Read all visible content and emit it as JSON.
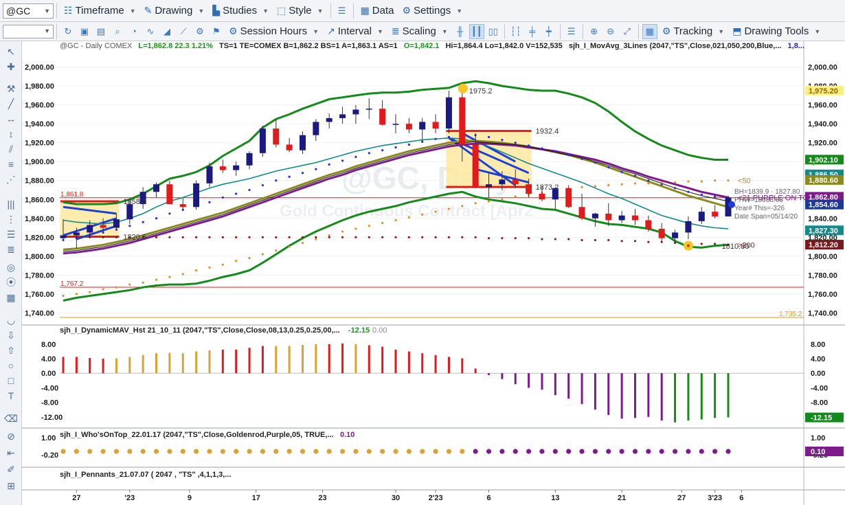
{
  "toolbar1": {
    "symbol": "@GC",
    "timeframe": "Timeframe",
    "drawing": "Drawing",
    "studies": "Studies",
    "style": "Style",
    "data": "Data",
    "settings": "Settings"
  },
  "toolbar2": {
    "session_hours": "Session Hours",
    "interval": "Interval",
    "scaling": "Scaling",
    "tracking": "Tracking",
    "drawing_tools": "Drawing Tools"
  },
  "header": {
    "symbol_label": "@GC - Daily  COMEX",
    "stats": "L=1,862.8  22.3  1.21%",
    "quote": "TS=1  TE=COMEX  B=1,862.2  BS=1  A=1,863.1  AS=1",
    "ohlcv": "O=1,842.1  Hi=1,864.4  Lo=1,842.0  V=152,535",
    "study": "sjh_I_MovAvg_3Lines (2047,\"TS\",Close,021,050,200,Blue,...",
    "study_tail": "1,8..."
  },
  "watermark": {
    "symbol": "@GC, Daily",
    "description": "Gold Continuous Contract [Apr2"
  },
  "colors": {
    "up_candle": "#1a1a80",
    "down_candle": "#e31a1a",
    "bb_band": "#138a1a",
    "ma_teal": "#138a8a",
    "ma_olive": "#8b8a1c",
    "ma_purple": "#7d1a8c",
    "hist_red": "#e21a1a",
    "hist_gold": "#dca231",
    "hist_purple": "#7e1a8d",
    "hist_green": "#148a1a"
  },
  "chart_data": {
    "type": "candlestick",
    "price_axis": {
      "ticks": [
        "2,000.00",
        "1,980.00",
        "1,960.00",
        "1,940.00",
        "1,920.00",
        "1,900.00",
        "1,880.00",
        "1,860.00",
        "1,840.00",
        "1,820.00",
        "1,800.00",
        "1,780.00",
        "1,760.00",
        "1,740.00"
      ],
      "ylim": [
        1733,
        2007
      ]
    },
    "date_axis": [
      "27",
      "'23",
      "9",
      "17",
      "23",
      "30",
      "2'23",
      "6",
      "13",
      "21",
      "27",
      "3'23",
      "6"
    ],
    "candles": [
      [
        1819,
        1839,
        1816,
        1822
      ],
      [
        1822,
        1830,
        1808,
        1825
      ],
      [
        1825,
        1838,
        1820,
        1833
      ],
      [
        1833,
        1840,
        1825,
        1830
      ],
      [
        1830,
        1845,
        1828,
        1839
      ],
      [
        1839,
        1858,
        1834,
        1855
      ],
      [
        1855,
        1873,
        1850,
        1868
      ],
      [
        1868,
        1878,
        1862,
        1876
      ],
      [
        1876,
        1880,
        1855,
        1855
      ],
      [
        1855,
        1862,
        1848,
        1852
      ],
      [
        1852,
        1880,
        1849,
        1877
      ],
      [
        1877,
        1899,
        1873,
        1895
      ],
      [
        1895,
        1902,
        1888,
        1891
      ],
      [
        1891,
        1900,
        1885,
        1896
      ],
      [
        1896,
        1911,
        1892,
        1909
      ],
      [
        1909,
        1938,
        1905,
        1935
      ],
      [
        1935,
        1945,
        1915,
        1918
      ],
      [
        1918,
        1925,
        1910,
        1912
      ],
      [
        1912,
        1932,
        1908,
        1928
      ],
      [
        1928,
        1945,
        1922,
        1942
      ],
      [
        1942,
        1951,
        1935,
        1946
      ],
      [
        1946,
        1958,
        1940,
        1950
      ],
      [
        1950,
        1960,
        1940,
        1955
      ],
      [
        1955,
        1967,
        1945,
        1956
      ],
      [
        1956,
        1965,
        1938,
        1939
      ],
      [
        1939,
        1950,
        1930,
        1940
      ],
      [
        1940,
        1946,
        1930,
        1934
      ],
      [
        1934,
        1946,
        1920,
        1942
      ],
      [
        1942,
        1950,
        1930,
        1935
      ],
      [
        1935,
        1975,
        1930,
        1968
      ],
      [
        1968,
        1975,
        1900,
        1918
      ],
      [
        1918,
        1930,
        1872,
        1873
      ],
      [
        1873,
        1888,
        1862,
        1876
      ],
      [
        1876,
        1890,
        1870,
        1881
      ],
      [
        1881,
        1892,
        1872,
        1876
      ],
      [
        1876,
        1882,
        1862,
        1866
      ],
      [
        1866,
        1874,
        1858,
        1860
      ],
      [
        1860,
        1873,
        1850,
        1872
      ],
      [
        1872,
        1875,
        1851,
        1852
      ],
      [
        1852,
        1866,
        1838,
        1840
      ],
      [
        1840,
        1846,
        1831,
        1845
      ],
      [
        1845,
        1856,
        1832,
        1838
      ],
      [
        1838,
        1848,
        1835,
        1843
      ],
      [
        1843,
        1850,
        1833,
        1838
      ],
      [
        1838,
        1843,
        1826,
        1829
      ],
      [
        1829,
        1835,
        1815,
        1819
      ],
      [
        1819,
        1828,
        1814,
        1825
      ],
      [
        1825,
        1842,
        1818,
        1837
      ],
      [
        1837,
        1852,
        1834,
        1847
      ],
      [
        1847,
        1854,
        1840,
        1842
      ],
      [
        1842,
        1864,
        1842,
        1862
      ]
    ],
    "ma21": [
      1838,
      1836,
      1835,
      1834,
      1836,
      1840,
      1845,
      1852,
      1858,
      1862,
      1867,
      1872,
      1876,
      1879,
      1882,
      1886,
      1890,
      1893,
      1896,
      1899,
      1903,
      1907,
      1911,
      1914,
      1917,
      1919,
      1921,
      1923,
      1924,
      1925,
      1924,
      1921,
      1916,
      1910,
      1904,
      1898,
      1893,
      1888,
      1883,
      1878,
      1872,
      1866,
      1861,
      1855,
      1849,
      1843,
      1839,
      1835,
      1832,
      1830,
      1829
    ],
    "bb_upper": [
      1857,
      1855,
      1855,
      1855,
      1856,
      1860,
      1866,
      1874,
      1882,
      1885,
      1889,
      1896,
      1906,
      1914,
      1922,
      1936,
      1945,
      1950,
      1956,
      1961,
      1966,
      1968,
      1970,
      1972,
      1973,
      1973,
      1974,
      1976,
      1977,
      1978,
      1983,
      1985,
      1983,
      1980,
      1978,
      1976,
      1975,
      1975,
      1972,
      1968,
      1962,
      1953,
      1942,
      1932,
      1924,
      1917,
      1912,
      1907,
      1904,
      1902,
      1902
    ],
    "bb_lower": [
      1753,
      1756,
      1758,
      1760,
      1762,
      1764,
      1767,
      1769,
      1770,
      1770,
      1771,
      1774,
      1778,
      1781,
      1785,
      1793,
      1802,
      1811,
      1819,
      1826,
      1832,
      1838,
      1843,
      1847,
      1850,
      1853,
      1857,
      1860,
      1863,
      1866,
      1868,
      1863,
      1860,
      1858,
      1856,
      1853,
      1850,
      1849,
      1845,
      1841,
      1837,
      1834,
      1833,
      1831,
      1829,
      1825,
      1816,
      1810,
      1809,
      1811,
      1812
    ],
    "ma50_olive": [
      1807,
      1808,
      1810,
      1812,
      1815,
      1818,
      1822,
      1826,
      1830,
      1834,
      1838,
      1842,
      1846,
      1851,
      1856,
      1861,
      1866,
      1871,
      1876,
      1881,
      1886,
      1890,
      1895,
      1899,
      1903,
      1907,
      1911,
      1914,
      1917,
      1920,
      1922,
      1922,
      1921,
      1920,
      1918,
      1916,
      1913,
      1910,
      1907,
      1903,
      1899,
      1894,
      1889,
      1884,
      1879,
      1874,
      1869,
      1864,
      1860,
      1856,
      1852
    ],
    "ma50_purple": [
      1803,
      1804,
      1806,
      1808,
      1811,
      1814,
      1818,
      1822,
      1826,
      1830,
      1834,
      1838,
      1842,
      1847,
      1852,
      1857,
      1862,
      1867,
      1872,
      1877,
      1882,
      1886,
      1891,
      1895,
      1899,
      1903,
      1907,
      1910,
      1913,
      1916,
      1918,
      1919,
      1919,
      1918,
      1917,
      1915,
      1913,
      1911,
      1908,
      1905,
      1902,
      1898,
      1893,
      1889,
      1884,
      1880,
      1876,
      1872,
      1868,
      1865,
      1862
    ],
    "ma50_black": [
      1805,
      1806,
      1808,
      1810,
      1813,
      1816,
      1820,
      1824,
      1828,
      1832,
      1836,
      1840,
      1844,
      1849,
      1854,
      1859,
      1864,
      1869,
      1874,
      1879,
      1884,
      1888,
      1893,
      1897,
      1901,
      1905,
      1909,
      1912,
      1915,
      1918,
      1920,
      1921,
      1920,
      1919,
      1918,
      1916,
      1913,
      1910,
      1907,
      1904,
      1900,
      1896,
      1891,
      1887,
      1882,
      1877,
      1872,
      1868,
      1864,
      1861,
      1858
    ],
    "dots_blue": [
      1817,
      1819,
      1822,
      1825,
      1828,
      1832,
      1836,
      1840,
      1845,
      1849,
      1853,
      1857,
      1862,
      1866,
      1870,
      1875,
      1880,
      1884,
      1888,
      1892,
      1897,
      1901,
      1905,
      1909,
      1912,
      1915,
      1918,
      1921,
      1924,
      1926,
      1929,
      1928,
      1926,
      1923,
      1920,
      1917,
      1914,
      1911,
      1907,
      1903,
      1899,
      1894,
      1889,
      1885,
      1880,
      1876,
      1872,
      1868,
      1865,
      1863,
      1862
    ],
    "dots_orange": [
      1758,
      1760,
      1762,
      1765,
      1767,
      1770,
      1772,
      1775,
      1778,
      1781,
      1785,
      1788,
      1791,
      1795,
      1798,
      1802,
      1806,
      1810,
      1814,
      1818,
      1822,
      1826,
      1829,
      1832,
      1835,
      1838,
      1841,
      1844,
      1847,
      1850,
      1853,
      1856,
      1858,
      1860,
      1863,
      1865,
      1867,
      1869,
      1871,
      1873,
      1874,
      1875,
      1876,
      1877,
      1877,
      1878,
      1878,
      1879,
      1879,
      1880,
      1880
    ],
    "dots_maroon": [
      1820,
      1820,
      1820,
      1820,
      1820,
      1820,
      1820,
      1820,
      1820,
      1820,
      1820,
      1820,
      1820,
      1820,
      1820,
      1820,
      1820,
      1820,
      1820,
      1820,
      1820,
      1820,
      1820,
      1820,
      1820,
      1820,
      1820,
      1820,
      1820,
      1820,
      1820,
      1820,
      1819,
      1819,
      1819,
      1819,
      1818,
      1818,
      1818,
      1817,
      1817,
      1817,
      1816,
      1816,
      1815,
      1815,
      1814,
      1814,
      1813,
      1813,
      1812
    ],
    "hlines": [
      {
        "label": "1,861.8",
        "value": 1861.8,
        "color": "#e31a1a"
      },
      {
        "label": "1,767.2",
        "value": 1767.2,
        "color": "#e31a1a"
      },
      {
        "label": "1,735.2",
        "value": 1735.2,
        "color": "#e39a20"
      }
    ],
    "annotations": [
      {
        "text": "1975.2",
        "bar": 30,
        "value": 1975.2
      },
      {
        "text": "1932.4",
        "bar": 35,
        "value": 1932.4
      },
      {
        "text": "1873.2",
        "bar": 35,
        "value": 1873.2
      },
      {
        "text": "1858.0",
        "bar": 4,
        "value": 1858.0
      },
      {
        "text": "1820.6",
        "bar": 4,
        "value": 1820.6
      },
      {
        "text": "1810.80",
        "bar": 49,
        "value": 1810.8
      },
      {
        "text": "<50",
        "bar": 50,
        "value": 1880.0
      },
      {
        "text": ">200",
        "bar": 50,
        "value": 1812.0
      },
      {
        "text": "<21 PURPLE ON TOP",
        "bar": 50,
        "value": 1862.0
      }
    ],
    "right_labels": [
      {
        "text": "1,975.20",
        "value": 1975.2,
        "bg": "#ffee80",
        "fg": "#8a6a00"
      },
      {
        "text": "1,902.10",
        "value": 1902.1,
        "bg": "#138a1a",
        "fg": "#ffffff"
      },
      {
        "text": "1,886.50",
        "value": 1886.5,
        "bg": "#138a8a",
        "fg": "#ffffff"
      },
      {
        "text": "1,880.60",
        "value": 1880.6,
        "bg": "#8b8a1c",
        "fg": "#ffffff"
      },
      {
        "text": "1,862.80",
        "value": 1862.8,
        "bg": "#7d1a8c",
        "fg": "#ffffff"
      },
      {
        "text": "1,854.60",
        "value": 1854.6,
        "bg": "#1a3a9a",
        "fg": "#ffffff"
      },
      {
        "text": "1,827.30",
        "value": 1827.3,
        "bg": "#138a8a",
        "fg": "#ffffff"
      },
      {
        "text": "1,812.20",
        "value": 1812.2,
        "bg": "#7a1a1a",
        "fg": "#ffffff"
      }
    ],
    "side_text": [
      "BH=1839.9 · 1827.80",
      "PHW=18088.68",
      "Year# This=-326",
      "Date Span=05/14/20"
    ],
    "panel1": {
      "title": "sjh_I_DynamicMAV_Hst 21_10_11 (2047,\"TS\",Close,Close,08,13,0.25,0.25,00,...",
      "value1": "-12.15",
      "value2": "0.00",
      "ticks": [
        "8.00",
        "4.00",
        "0.00",
        "-4.00",
        "-8.00",
        "-12.00"
      ],
      "ylim": [
        -14.5,
        11
      ],
      "right_label": "-12.15",
      "values": [
        4.5,
        4.5,
        4.2,
        4.0,
        4.1,
        4.5,
        5.0,
        5.5,
        5.6,
        5.5,
        6.0,
        6.3,
        6.5,
        6.5,
        7.0,
        7.5,
        7.5,
        7.5,
        7.8,
        8.0,
        8.0,
        8.2,
        8.0,
        7.7,
        7.3,
        6.5,
        6.0,
        5.5,
        5.0,
        4.5,
        4.1,
        1.3,
        -0.5,
        -1.6,
        -3.0,
        -4.0,
        -4.5,
        -6.0,
        -7.0,
        -8.5,
        -10.0,
        -11.5,
        -12.5,
        -12.3,
        -12.0,
        -13.0,
        -13.5,
        -13.0,
        -12.7,
        -12.3,
        -12.15
      ],
      "colors": [
        "red",
        "red",
        "red",
        "red",
        "gold",
        "gold",
        "gold",
        "gold",
        "gold",
        "gold",
        "gold",
        "gold",
        "red",
        "red",
        "red",
        "red",
        "gold",
        "gold",
        "gold",
        "gold",
        "red",
        "red",
        "gold",
        "red",
        "red",
        "red",
        "red",
        "red",
        "red",
        "red",
        "red",
        "red",
        "purple",
        "purple",
        "purple",
        "purple",
        "purple",
        "purple",
        "purple",
        "purple",
        "purple",
        "purple",
        "purple",
        "purple",
        "purple",
        "purple",
        "green",
        "green",
        "green",
        "green",
        "green"
      ]
    },
    "panel2": {
      "title": "sjh_I_Who'sOnTop_22.01.17 (2047,\"TS\",Close,Goldenrod,Purple,05, TRUE,...",
      "value1": "0.10",
      "ticks": [
        "1.00",
        "-0.20"
      ],
      "right_label": "0.10",
      "gold_count": 31
    },
    "panel3": {
      "title": "sjh_I_Pennants_21.07.07 ( 2047 , \"TS\" ,4,1,1,3,..."
    }
  }
}
